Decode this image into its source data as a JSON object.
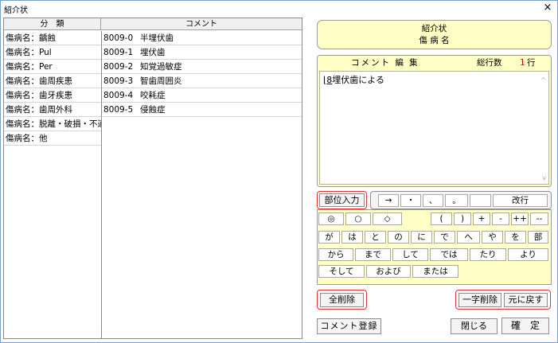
{
  "window": {
    "title": "紹介状",
    "close_icon": "×"
  },
  "list": {
    "headers": {
      "category": "分　類",
      "comment": "コメント"
    },
    "categories": [
      "傷病名：齲蝕",
      "傷病名：Pul",
      "傷病名：Per",
      "傷病名：歯周疾患",
      "傷病名：歯牙疾患",
      "傷病名：歯周外科",
      "傷病名：脱離・破損・不適",
      "傷病名：他"
    ],
    "comments": [
      {
        "code": "8009-0",
        "text": "半埋伏歯"
      },
      {
        "code": "8009-1",
        "text": "埋伏歯"
      },
      {
        "code": "8009-2",
        "text": "知覚過敏症"
      },
      {
        "code": "8009-3",
        "text": "智歯周囲炎"
      },
      {
        "code": "8009-4",
        "text": "咬耗症"
      },
      {
        "code": "8009-5",
        "text": "侵蝕症"
      }
    ]
  },
  "header": {
    "line1": "紹介状",
    "line2": "傷 病 名"
  },
  "editor": {
    "title": "コメント 編 集",
    "total_label": "総行数",
    "line_count": "1",
    "line_unit": "行",
    "content_prefix": "⌊",
    "content_code": "8",
    "content_text": "埋伏歯による",
    "scroll_up_icon": "^",
    "scroll_down_icon": "v"
  },
  "buttons": {
    "site_input": "部位入力",
    "newline": "改行",
    "clear_all": "全削除",
    "delete_char": "一字削除",
    "undo": "元に戻す",
    "register_comment": "コメント登録",
    "close": "閉じる",
    "confirm": "確　定"
  },
  "punct_keys": [
    "→",
    "・",
    "、",
    "。",
    ""
  ],
  "symbol_keys": [
    "◎",
    "○",
    "◇",
    "(",
    ")",
    "+",
    "-",
    "++",
    "--"
  ],
  "word_keys": {
    "row2": [
      "が",
      "は",
      "と",
      "の",
      "に",
      "で",
      "へ",
      "や",
      "を",
      "部"
    ],
    "row3": [
      "から",
      "まで",
      "して",
      "では",
      "たり",
      "より"
    ],
    "row4": [
      "そして",
      "および",
      "または"
    ]
  }
}
